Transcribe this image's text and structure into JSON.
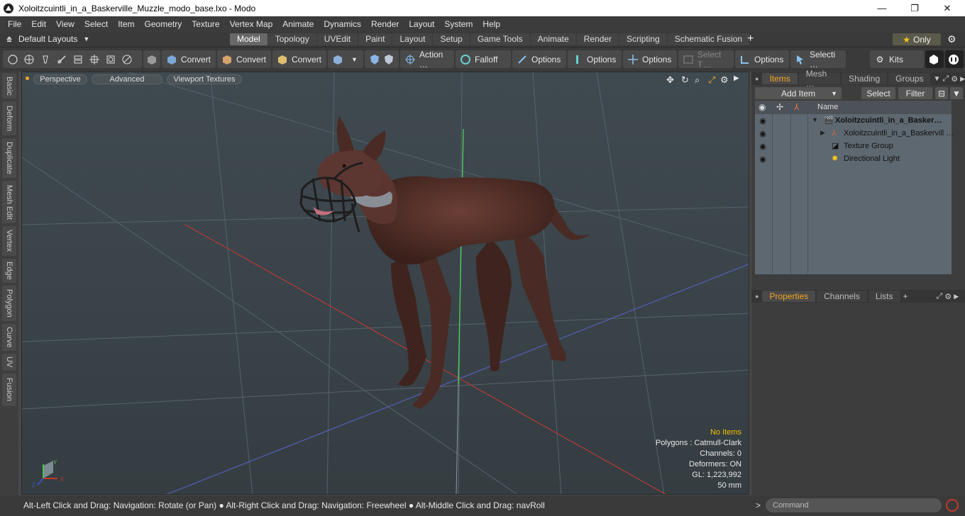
{
  "window": {
    "title": "Xoloitzcuintli_in_a_Baskerville_Muzzle_modo_base.lxo - Modo",
    "minimize": "—",
    "maximize": "❐",
    "close": "✕"
  },
  "menu": [
    "File",
    "Edit",
    "View",
    "Select",
    "Item",
    "Geometry",
    "Texture",
    "Vertex Map",
    "Animate",
    "Dynamics",
    "Render",
    "Layout",
    "System",
    "Help"
  ],
  "layoutbar": {
    "default_layouts": "Default Layouts",
    "tabs": [
      "Model",
      "Topology",
      "UVEdit",
      "Paint",
      "Layout",
      "Setup",
      "Game Tools",
      "Animate",
      "Render",
      "Scripting",
      "Schematic Fusion"
    ],
    "active_tab": "Model",
    "plus": "+",
    "only_label": "Only",
    "star": "★",
    "gear": "⚙"
  },
  "toolbar": {
    "convert1": "Convert",
    "convert2": "Convert",
    "convert3": "Convert",
    "action": "Action …",
    "falloff": "Falloff",
    "options1": "Options",
    "options2": "Options",
    "options3": "Options",
    "select_t": "Select T…",
    "options4": "Options",
    "selecti": "Selecti …",
    "kits": "Kits"
  },
  "left_tabs": [
    "Basic",
    "Deform",
    "Duplicate",
    "Mesh Edit",
    "Vertex",
    "Edge",
    "Polygon",
    "Curve",
    "UV",
    "Fusion"
  ],
  "viewport": {
    "perspective": "Perspective",
    "advanced": "Advanced",
    "viewport_textures": "Viewport Textures",
    "info": {
      "no_items": "No Items",
      "polygons": "Polygons : Catmull-Clark",
      "channels": "Channels: 0",
      "deformers": "Deformers: ON",
      "gl": "GL: 1,223,992",
      "focal": "50 mm"
    },
    "axis": {
      "y": "Y",
      "x": "X",
      "z": "Z"
    }
  },
  "items_panel": {
    "tabs": [
      "Items",
      "Mesh …",
      "Shading",
      "Groups"
    ],
    "active_tab": "Items",
    "add_item": "Add Item",
    "select": "Select",
    "filter": "Filter",
    "header_name": "Name",
    "rows": [
      {
        "label": "Xoloitzcuintli_in_a_Basker…",
        "bold": true
      },
      {
        "label": "Xoloitzcuintli_in_a_Baskervill …",
        "bold": false
      },
      {
        "label": "Texture Group",
        "bold": false
      },
      {
        "label": "Directional Light",
        "bold": false
      }
    ]
  },
  "properties_panel": {
    "tabs": [
      "Properties",
      "Channels",
      "Lists"
    ],
    "active_tab": "Properties",
    "plus": "+"
  },
  "statusbar": {
    "hint": "Alt-Left Click and Drag: Navigation: Rotate (or Pan) ● Alt-Right Click and Drag: Navigation: Freewheel ● Alt-Middle Click and Drag: navRoll",
    "command_placeholder": "Command",
    "arrow": ">"
  },
  "colors": {
    "accent": "#f5a623",
    "viewport_bg": "#3d474d",
    "panel_bg": "#3d3d3d",
    "x_axis": "#c0392b",
    "y_axis": "#4caf50",
    "z_axis": "#3f51b5"
  }
}
